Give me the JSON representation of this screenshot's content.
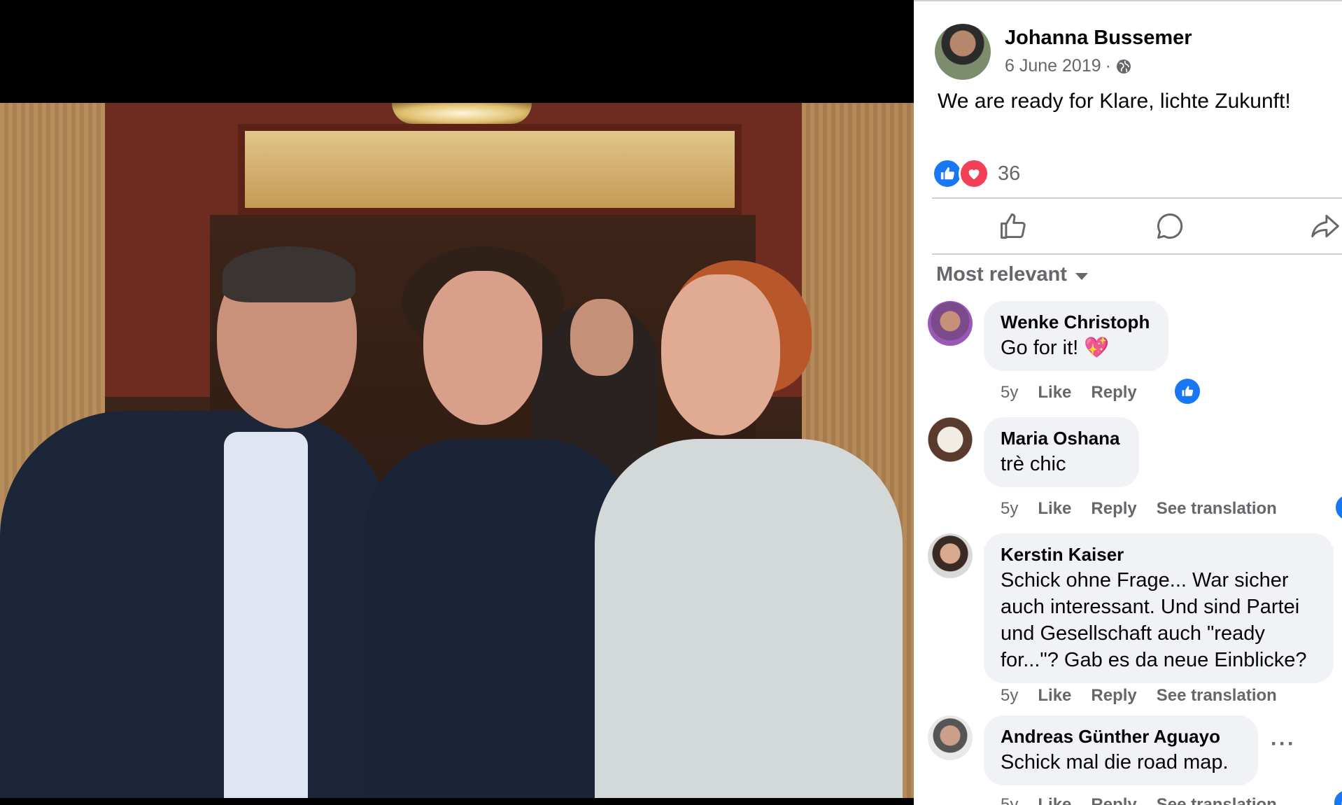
{
  "post": {
    "author": "Johanna Bussemer",
    "date": "6 June 2019",
    "separator": "·",
    "text": "We are ready for Klare, lichte Zukunft!",
    "reaction_count": "36",
    "sort_label": "Most relevant"
  },
  "comments": [
    {
      "author": "Wenke Christoph",
      "text": "Go for it! 💖",
      "age": "5y",
      "like": "Like",
      "reply": "Reply",
      "translate": ""
    },
    {
      "author": "Maria Oshana",
      "text": "trè chic",
      "age": "5y",
      "like": "Like",
      "reply": "Reply",
      "translate": "See translation"
    },
    {
      "author": "Kerstin Kaiser",
      "text": "Schick ohne Frage... War sicher auch interessant. Und sind Partei und Gesellschaft auch \"ready for...\"? Gab es da neue Einblicke?",
      "age": "5y",
      "like": "Like",
      "reply": "Reply",
      "translate": "See translation"
    },
    {
      "author": "Andreas Günther Aguayo",
      "text": "Schick mal die road map.",
      "age": "5y",
      "like": "Like",
      "reply": "Reply",
      "translate": "See translation"
    }
  ],
  "colors": {
    "brand_blue": "#1877f2",
    "love_red": "#f33e58",
    "muted_text": "#65676b",
    "bubble_bg": "#f0f2f5"
  },
  "icons": [
    "globe-icon",
    "like-reaction-icon",
    "love-reaction-icon",
    "like-action-icon",
    "comment-action-icon",
    "share-action-icon",
    "chevron-down-icon",
    "more-options-icon"
  ]
}
